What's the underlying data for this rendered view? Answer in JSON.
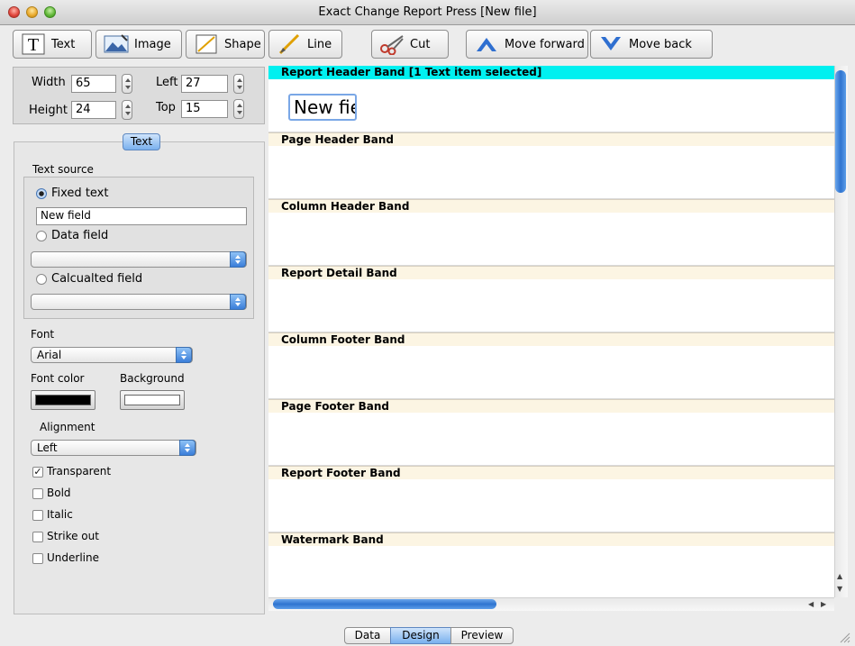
{
  "window": {
    "title": "Exact Change Report Press [New file]"
  },
  "toolbar": {
    "text": "Text",
    "image": "Image",
    "shape": "Shape",
    "line": "Line",
    "cut": "Cut",
    "move_forward": "Move forward",
    "move_back": "Move back"
  },
  "dimensions": {
    "width_label": "Width",
    "width_value": "65",
    "height_label": "Height",
    "height_value": "24",
    "left_label": "Left",
    "left_value": "27",
    "top_label": "Top",
    "top_value": "15"
  },
  "panel": {
    "tab_label": "Text",
    "text_source_label": "Text source",
    "fixed_text_label": "Fixed text",
    "fixed_text_value": "New field",
    "data_field_label": "Data field",
    "calculated_field_label": "Calcualted field",
    "font_label": "Font",
    "font_value": "Arial",
    "font_color_label": "Font color",
    "background_label": "Background",
    "alignment_label": "Alignment",
    "alignment_value": "Left",
    "options": [
      {
        "label": "Transparent",
        "checked": true
      },
      {
        "label": "Bold",
        "checked": false
      },
      {
        "label": "Italic",
        "checked": false
      },
      {
        "label": "Strike out",
        "checked": false
      },
      {
        "label": "Underline",
        "checked": false
      }
    ],
    "font_color": "#000000",
    "background_color": "#ffffff"
  },
  "bands": [
    "Report Header Band [1 Text item selected]",
    "Page Header Band",
    "Column Header Band",
    "Report Detail Band",
    "Column Footer Band",
    "Page Footer Band",
    "Report Footer Band",
    "Watermark Band"
  ],
  "canvas": {
    "selected_item_text": "New fie"
  },
  "bottom_tabs": {
    "data": "Data",
    "design": "Design",
    "preview": "Preview"
  },
  "colors": {
    "selected_band": "#00f0f0",
    "band_header": "#fcf5e3",
    "accent": "#3a7ed9"
  }
}
